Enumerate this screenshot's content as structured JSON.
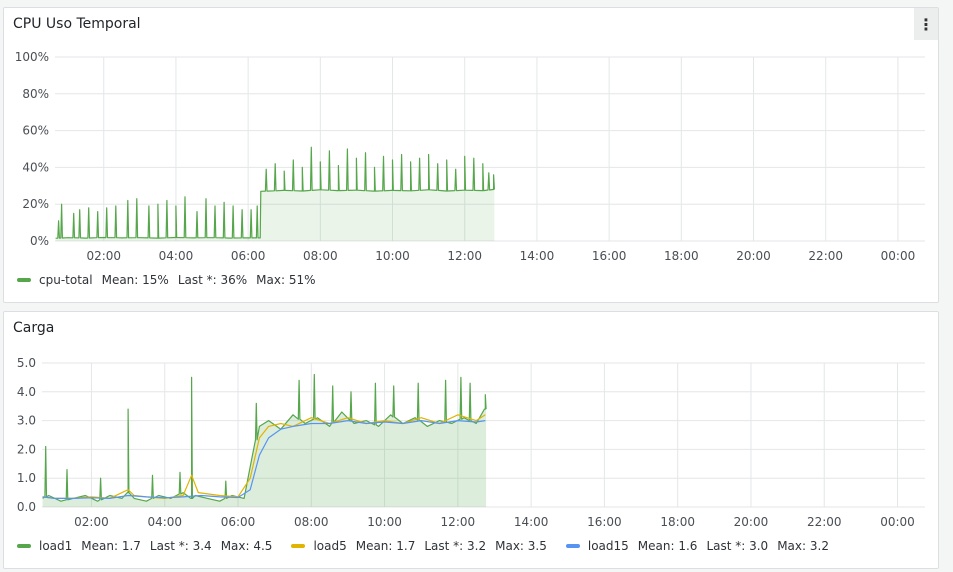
{
  "panels": {
    "cpu": {
      "title": "CPU Uso Temporal",
      "menu_icon": "kebab-menu-icon",
      "legend": [
        {
          "name": "cpu-total",
          "color": "#56a64b",
          "stats": [
            "Mean: 15%",
            "Last *: 36%",
            "Max: 51%"
          ]
        }
      ]
    },
    "load": {
      "title": "Carga",
      "legend": [
        {
          "name": "load1",
          "color": "#56a64b",
          "stats": [
            "Mean: 1.7",
            "Last *: 3.4",
            "Max: 4.5"
          ]
        },
        {
          "name": "load5",
          "color": "#e0b400",
          "stats": [
            "Mean: 1.7",
            "Last *: 3.2",
            "Max: 3.5"
          ]
        },
        {
          "name": "load15",
          "color": "#5794f2",
          "stats": [
            "Mean: 1.6",
            "Last *: 3.0",
            "Max: 3.2"
          ]
        }
      ]
    }
  },
  "chart_data": [
    {
      "type": "area",
      "title": "CPU Uso Temporal",
      "x_ticks": [
        "02:00",
        "04:00",
        "06:00",
        "08:00",
        "10:00",
        "12:00",
        "14:00",
        "16:00",
        "18:00",
        "20:00",
        "22:00",
        "00:00"
      ],
      "y_ticks": [
        "0%",
        "20%",
        "40%",
        "60%",
        "80%",
        "100%"
      ],
      "xlim": [
        "00:39",
        "00:45"
      ],
      "ylim": [
        0,
        100
      ],
      "grid": true,
      "legend_position": "bottom-left",
      "series": [
        {
          "name": "cpu-total",
          "color": "#56a64b",
          "x": [
            "00:40",
            "01:00",
            "01:30",
            "02:00",
            "02:30",
            "03:00",
            "03:30",
            "04:00",
            "04:30",
            "05:00",
            "05:30",
            "06:00",
            "06:20",
            "06:21",
            "07:00",
            "07:30",
            "08:00",
            "08:30",
            "09:00",
            "09:30",
            "10:00",
            "10:30",
            "11:00",
            "11:30",
            "12:00",
            "12:30",
            "12:48"
          ],
          "values": [
            1.5,
            1.8,
            1.6,
            1.9,
            1.7,
            1.8,
            1.6,
            1.9,
            1.7,
            1.8,
            1.6,
            1.7,
            1.7,
            27,
            27.5,
            27.2,
            27.8,
            27.4,
            27.6,
            27.1,
            27.5,
            27.3,
            27.8,
            27.2,
            27.6,
            27.4,
            28
          ],
          "spikes": [
            {
              "x": "00:45",
              "y": 11
            },
            {
              "x": "00:50",
              "y": 20
            },
            {
              "x": "01:10",
              "y": 15
            },
            {
              "x": "01:20",
              "y": 17
            },
            {
              "x": "01:35",
              "y": 18
            },
            {
              "x": "01:50",
              "y": 16
            },
            {
              "x": "02:05",
              "y": 18
            },
            {
              "x": "02:20",
              "y": 19
            },
            {
              "x": "02:40",
              "y": 22
            },
            {
              "x": "02:55",
              "y": 23
            },
            {
              "x": "03:15",
              "y": 19
            },
            {
              "x": "03:30",
              "y": 20
            },
            {
              "x": "03:45",
              "y": 22
            },
            {
              "x": "04:00",
              "y": 19
            },
            {
              "x": "04:15",
              "y": 24
            },
            {
              "x": "04:35",
              "y": 16
            },
            {
              "x": "04:50",
              "y": 23
            },
            {
              "x": "05:05",
              "y": 19
            },
            {
              "x": "05:20",
              "y": 21
            },
            {
              "x": "05:35",
              "y": 19
            },
            {
              "x": "05:50",
              "y": 17
            },
            {
              "x": "06:05",
              "y": 17
            },
            {
              "x": "06:15",
              "y": 19
            },
            {
              "x": "06:30",
              "y": 39
            },
            {
              "x": "06:45",
              "y": 42
            },
            {
              "x": "07:00",
              "y": 38
            },
            {
              "x": "07:15",
              "y": 44
            },
            {
              "x": "07:30",
              "y": 40
            },
            {
              "x": "07:45",
              "y": 51
            },
            {
              "x": "08:00",
              "y": 43
            },
            {
              "x": "08:15",
              "y": 49
            },
            {
              "x": "08:30",
              "y": 41
            },
            {
              "x": "08:45",
              "y": 50
            },
            {
              "x": "09:00",
              "y": 45
            },
            {
              "x": "09:15",
              "y": 48
            },
            {
              "x": "09:30",
              "y": 40
            },
            {
              "x": "09:45",
              "y": 46
            },
            {
              "x": "10:00",
              "y": 44
            },
            {
              "x": "10:15",
              "y": 47
            },
            {
              "x": "10:30",
              "y": 43
            },
            {
              "x": "10:45",
              "y": 45
            },
            {
              "x": "11:00",
              "y": 47
            },
            {
              "x": "11:15",
              "y": 42
            },
            {
              "x": "11:30",
              "y": 44
            },
            {
              "x": "11:45",
              "y": 39
            },
            {
              "x": "12:00",
              "y": 46
            },
            {
              "x": "12:15",
              "y": 45
            },
            {
              "x": "12:30",
              "y": 42
            },
            {
              "x": "12:40",
              "y": 37
            },
            {
              "x": "12:48",
              "y": 36
            }
          ]
        }
      ]
    },
    {
      "type": "area",
      "title": "Carga",
      "x_ticks": [
        "02:00",
        "04:00",
        "06:00",
        "08:00",
        "10:00",
        "12:00",
        "14:00",
        "16:00",
        "18:00",
        "20:00",
        "22:00",
        "00:00"
      ],
      "y_ticks": [
        "0.0",
        "1.0",
        "2.0",
        "3.0",
        "4.0",
        "5.0"
      ],
      "xlim": [
        "00:39",
        "00:45"
      ],
      "ylim": [
        0,
        5
      ],
      "grid": true,
      "legend_position": "bottom-left",
      "series": [
        {
          "name": "load1",
          "color": "#56a64b",
          "x": [
            "00:40",
            "00:50",
            "01:10",
            "01:30",
            "01:50",
            "02:10",
            "02:30",
            "02:50",
            "03:00",
            "03:10",
            "03:30",
            "03:50",
            "04:10",
            "04:30",
            "04:44",
            "04:50",
            "05:10",
            "05:30",
            "05:50",
            "06:10",
            "06:20",
            "06:35",
            "06:50",
            "07:10",
            "07:30",
            "07:50",
            "08:10",
            "08:30",
            "08:50",
            "09:10",
            "09:30",
            "09:50",
            "10:10",
            "10:30",
            "10:50",
            "11:10",
            "11:30",
            "11:50",
            "12:10",
            "12:30",
            "12:45"
          ],
          "values": [
            0.3,
            0.4,
            0.2,
            0.3,
            0.4,
            0.2,
            0.4,
            0.3,
            0.5,
            0.3,
            0.2,
            0.4,
            0.3,
            0.5,
            0.3,
            0.4,
            0.3,
            0.2,
            0.4,
            0.3,
            1.4,
            2.8,
            3.0,
            2.7,
            3.2,
            2.9,
            3.1,
            2.8,
            3.3,
            2.9,
            3.0,
            2.8,
            3.2,
            2.9,
            3.1,
            2.8,
            3.0,
            2.9,
            3.1,
            2.9,
            3.4
          ],
          "spikes": [
            {
              "x": "00:45",
              "y": 2.1
            },
            {
              "x": "01:20",
              "y": 1.3
            },
            {
              "x": "02:15",
              "y": 1.0
            },
            {
              "x": "03:00",
              "y": 3.4
            },
            {
              "x": "03:40",
              "y": 1.1
            },
            {
              "x": "04:25",
              "y": 1.2
            },
            {
              "x": "04:44",
              "y": 4.5
            },
            {
              "x": "05:40",
              "y": 0.9
            },
            {
              "x": "06:30",
              "y": 3.6
            },
            {
              "x": "07:40",
              "y": 4.4
            },
            {
              "x": "08:05",
              "y": 4.6
            },
            {
              "x": "08:35",
              "y": 4.2
            },
            {
              "x": "09:05",
              "y": 4.0
            },
            {
              "x": "09:45",
              "y": 4.3
            },
            {
              "x": "10:15",
              "y": 4.2
            },
            {
              "x": "10:55",
              "y": 4.3
            },
            {
              "x": "11:40",
              "y": 4.4
            },
            {
              "x": "12:05",
              "y": 4.5
            },
            {
              "x": "12:20",
              "y": 4.3
            },
            {
              "x": "12:45",
              "y": 3.9
            }
          ]
        },
        {
          "name": "load5",
          "color": "#e0b400",
          "x": [
            "00:40",
            "01:00",
            "01:30",
            "02:00",
            "02:30",
            "03:00",
            "03:10",
            "03:30",
            "04:00",
            "04:30",
            "04:44",
            "04:55",
            "05:30",
            "06:00",
            "06:20",
            "06:35",
            "06:50",
            "07:10",
            "07:30",
            "08:00",
            "08:30",
            "09:00",
            "09:30",
            "10:00",
            "10:30",
            "11:00",
            "11:30",
            "12:00",
            "12:30",
            "12:45"
          ],
          "values": [
            0.35,
            0.3,
            0.3,
            0.35,
            0.3,
            0.6,
            0.4,
            0.35,
            0.3,
            0.4,
            1.1,
            0.5,
            0.4,
            0.35,
            1.0,
            2.4,
            2.8,
            2.9,
            2.8,
            3.1,
            2.9,
            3.1,
            2.9,
            3.0,
            2.9,
            3.1,
            2.9,
            3.2,
            3.0,
            3.2
          ]
        },
        {
          "name": "load15",
          "color": "#5794f2",
          "x": [
            "00:40",
            "01:00",
            "01:30",
            "02:00",
            "02:30",
            "03:00",
            "03:30",
            "04:00",
            "04:30",
            "05:00",
            "05:30",
            "06:00",
            "06:20",
            "06:35",
            "06:50",
            "07:10",
            "07:30",
            "08:00",
            "08:30",
            "09:00",
            "09:30",
            "10:00",
            "10:30",
            "11:00",
            "11:30",
            "12:00",
            "12:30",
            "12:45"
          ],
          "values": [
            0.35,
            0.3,
            0.3,
            0.32,
            0.3,
            0.4,
            0.35,
            0.32,
            0.35,
            0.4,
            0.35,
            0.33,
            0.6,
            1.8,
            2.4,
            2.7,
            2.8,
            2.9,
            2.9,
            3.0,
            2.9,
            2.95,
            2.9,
            3.0,
            2.9,
            3.0,
            2.95,
            3.0
          ]
        }
      ]
    }
  ]
}
